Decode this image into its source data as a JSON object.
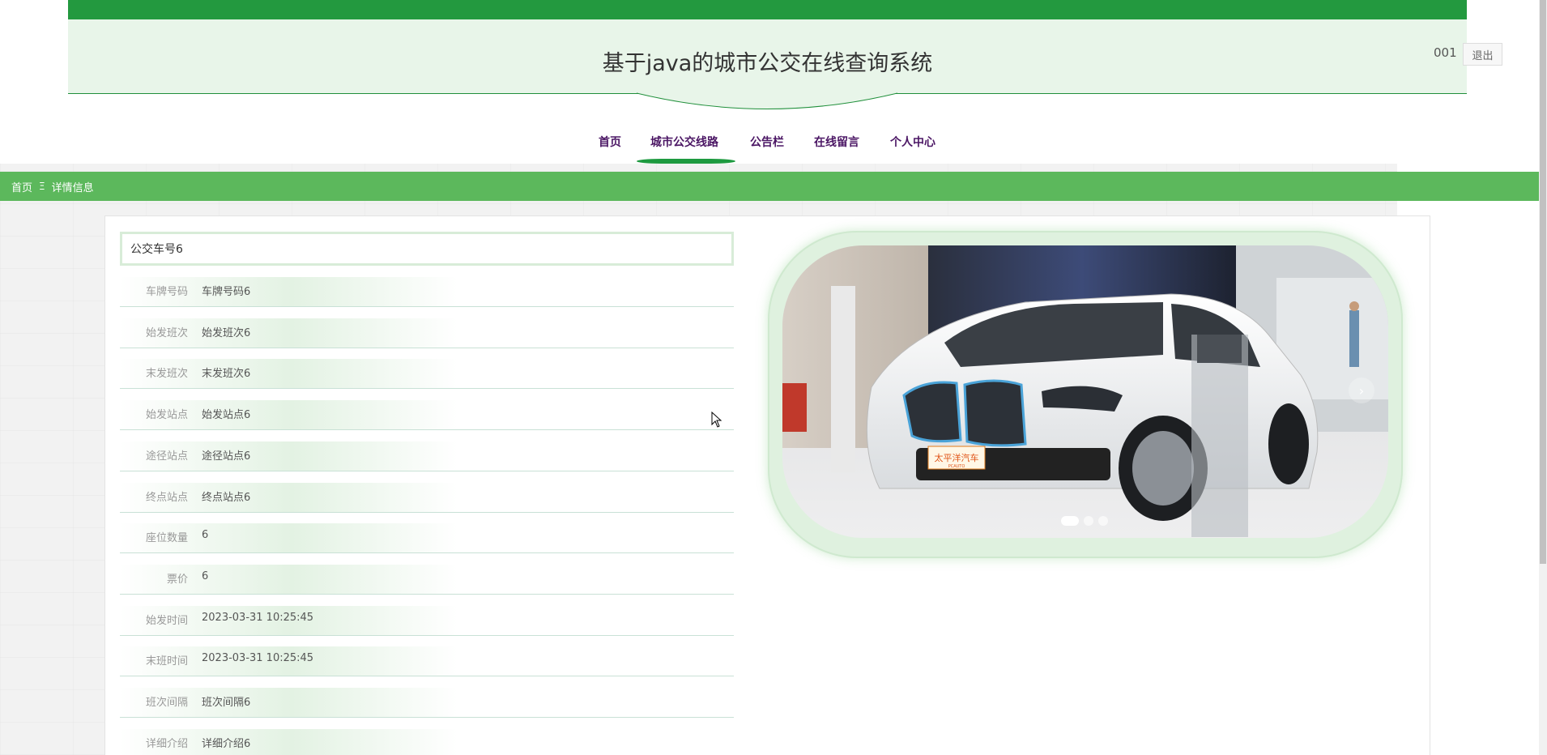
{
  "header": {
    "title": "基于java的城市公交在线查询系统",
    "user": "001",
    "logout_label": "退出"
  },
  "nav": {
    "items": [
      {
        "label": "首页"
      },
      {
        "label": "城市公交线路"
      },
      {
        "label": "公告栏"
      },
      {
        "label": "在线留言"
      },
      {
        "label": "个人中心"
      }
    ],
    "active": "城市公交线路"
  },
  "breadcrumb": {
    "home": "首页",
    "separator": "Ξ",
    "current": "详情信息"
  },
  "detail": {
    "title": "公交车号6",
    "fields": [
      {
        "label": "车牌号码",
        "value": "车牌号码6"
      },
      {
        "label": "始发班次",
        "value": "始发班次6"
      },
      {
        "label": "末发班次",
        "value": "末发班次6"
      },
      {
        "label": "始发站点",
        "value": "始发站点6"
      },
      {
        "label": "途径站点",
        "value": "途径站点6"
      },
      {
        "label": "终点站点",
        "value": "终点站点6"
      },
      {
        "label": "座位数量",
        "value": "6"
      },
      {
        "label": "票价",
        "value": "6"
      },
      {
        "label": "始发时间",
        "value": "2023-03-31 10:25:45"
      },
      {
        "label": "末班时间",
        "value": "2023-03-31 10:25:45"
      },
      {
        "label": "班次间隔",
        "value": "班次间隔6"
      },
      {
        "label": "详细介绍",
        "value": "详细介绍6"
      }
    ]
  },
  "carousel": {
    "next_label": "›",
    "slide_count": 3,
    "active_index": 0,
    "badge_text": "太平洋汽车",
    "badge_subtext": "PCAUTO"
  },
  "colors": {
    "top_strip": "#23993f",
    "header_bg": "#e8f5e9",
    "breadcrumb_bg": "#5cb85c",
    "nav_text": "#4b1664",
    "nav_underline": "#1d9a3f"
  }
}
